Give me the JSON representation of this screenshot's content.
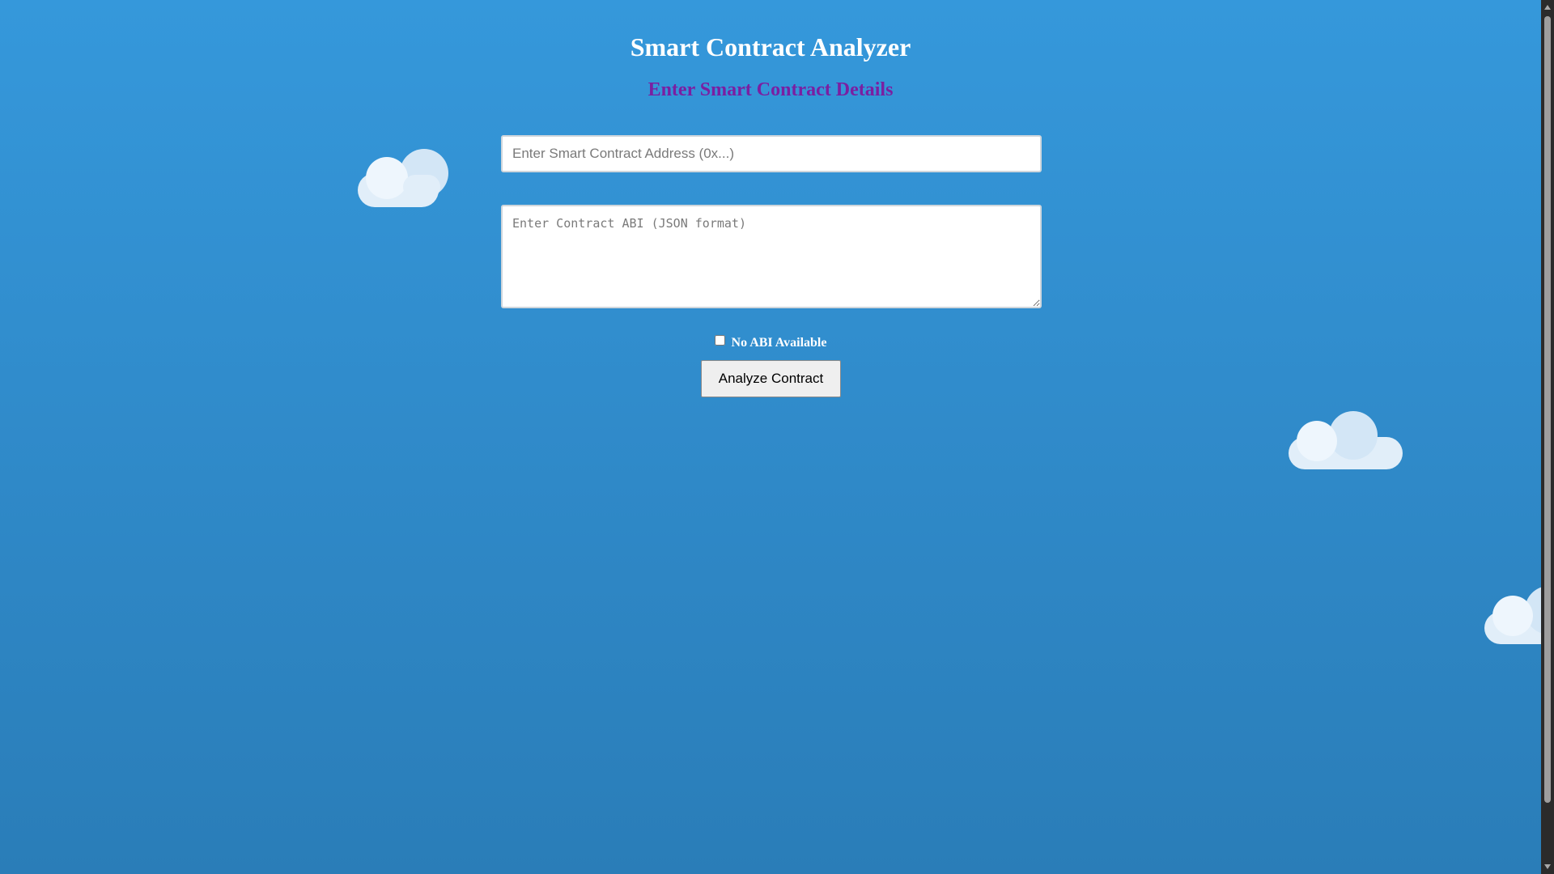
{
  "page": {
    "title": "Smart Contract Analyzer",
    "section_title": "Enter Smart Contract Details"
  },
  "form": {
    "address_value": "",
    "address_placeholder": "Enter Smart Contract Address (0x...)",
    "abi_value": "",
    "abi_placeholder": "Enter Contract ABI (JSON format)",
    "no_abi_label": "No ABI Available",
    "no_abi_checked": false,
    "analyze_label": "Analyze Contract"
  },
  "theme": {
    "background_top": "#3598db",
    "background_bottom": "#2a7db8",
    "section_title_color": "#7a1fa2",
    "cloud_color": "#e1eef9"
  }
}
